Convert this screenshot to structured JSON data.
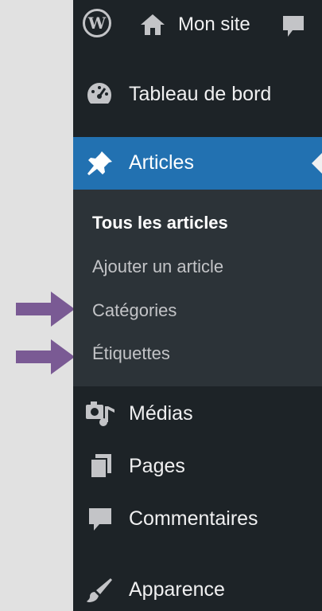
{
  "admin_bar": {
    "wp_logo": "W",
    "site_name": "Mon site"
  },
  "menu": {
    "dashboard": "Tableau de bord",
    "articles": "Articles",
    "submenu": [
      "Tous les articles",
      "Ajouter un article",
      "Catégories",
      "Étiquettes"
    ],
    "medias": "Médias",
    "pages": "Pages",
    "comments": "Commentaires",
    "appearance": "Apparence"
  },
  "colors": {
    "sidebar_bg": "#1d2327",
    "submenu_bg": "#2c3338",
    "active_bg": "#2271b1",
    "annotation_arrow": "#7a5a94"
  }
}
